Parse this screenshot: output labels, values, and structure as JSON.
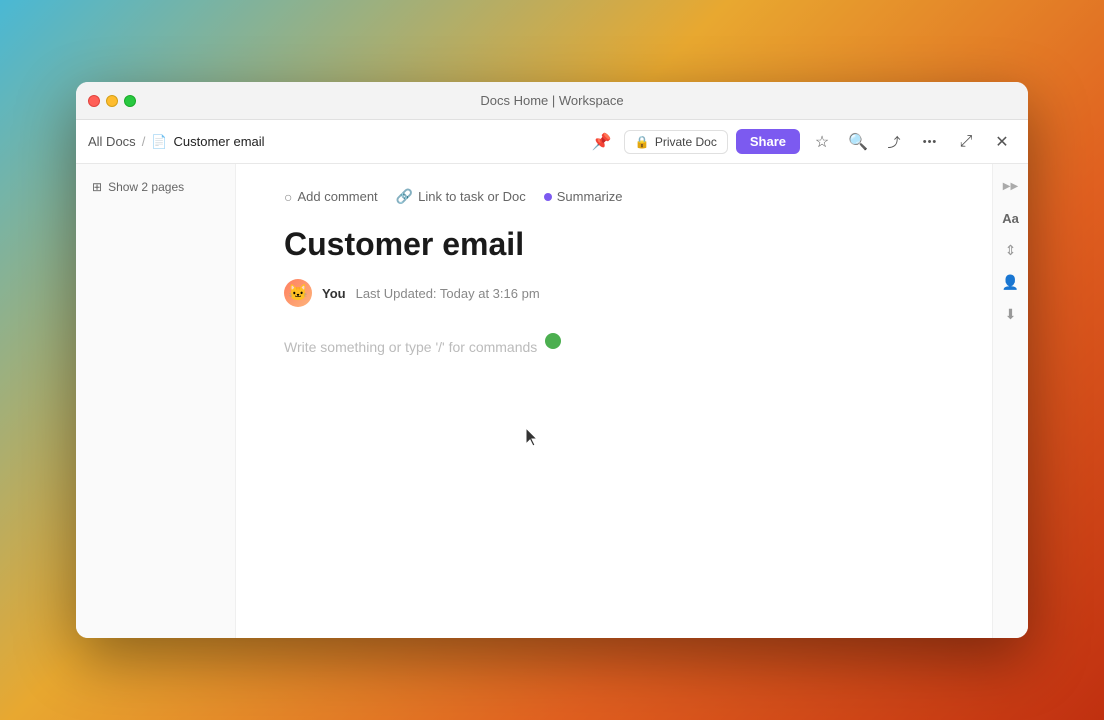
{
  "window": {
    "title": "Docs Home | Workspace"
  },
  "titlebar": {
    "title": "Docs Home | Workspace"
  },
  "toolbar": {
    "breadcrumb": {
      "all_docs": "All Docs",
      "separator": "/",
      "current_doc": "Customer email"
    },
    "private_doc_label": "Private Doc",
    "share_label": "Share"
  },
  "sidebar": {
    "show_pages_label": "Show 2 pages"
  },
  "editor_toolbar": {
    "add_comment": "Add comment",
    "link_to_task": "Link to task or Doc",
    "summarize": "Summarize"
  },
  "doc": {
    "title": "Customer email",
    "author": "You",
    "last_updated": "Last Updated: Today at 3:16 pm",
    "placeholder": "Write something or type '/' for commands"
  },
  "right_panel": {
    "icons": [
      "Aa",
      "↕",
      "👤",
      "↓"
    ]
  },
  "icons": {
    "comment": "💬",
    "link": "🔗",
    "star": "☆",
    "search": "🔍",
    "export": "→",
    "more": "•••",
    "fullscreen": "⤢",
    "close": "✕",
    "lock": "🔒",
    "pages": "⊞"
  }
}
